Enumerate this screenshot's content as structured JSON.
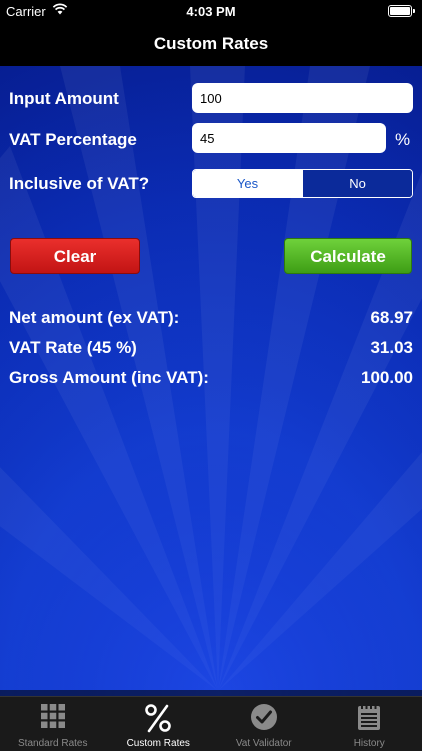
{
  "status": {
    "carrier": "Carrier",
    "time": "4:03 PM"
  },
  "nav": {
    "title": "Custom Rates"
  },
  "form": {
    "input_amount_label": "Input Amount",
    "input_amount_value": "100",
    "vat_percentage_label": "VAT Percentage",
    "vat_percentage_value": "45",
    "percent_sign": "%",
    "inclusive_label": "Inclusive of VAT?",
    "inclusive_options": [
      "Yes",
      "No"
    ],
    "inclusive_selected": "Yes"
  },
  "buttons": {
    "clear": "Clear",
    "calculate": "Calculate"
  },
  "results": [
    {
      "label": "Net amount (ex VAT):",
      "value": "68.97"
    },
    {
      "label": "VAT Rate (45 %)",
      "value": "31.03"
    },
    {
      "label": "Gross Amount (inc VAT):",
      "value": "100.00"
    }
  ],
  "tabs": [
    {
      "label": "Standard Rates",
      "icon": "grid-icon",
      "active": false
    },
    {
      "label": "Custom Rates",
      "icon": "percent-icon",
      "active": true
    },
    {
      "label": "Vat Validator",
      "icon": "checkmark-icon",
      "active": false
    },
    {
      "label": "History",
      "icon": "notepad-icon",
      "active": false
    }
  ],
  "colors": {
    "background_blue": "#1038c8",
    "clear_red": "#d42020",
    "calculate_green": "#52b526",
    "segment_text": "#1a57c8"
  }
}
